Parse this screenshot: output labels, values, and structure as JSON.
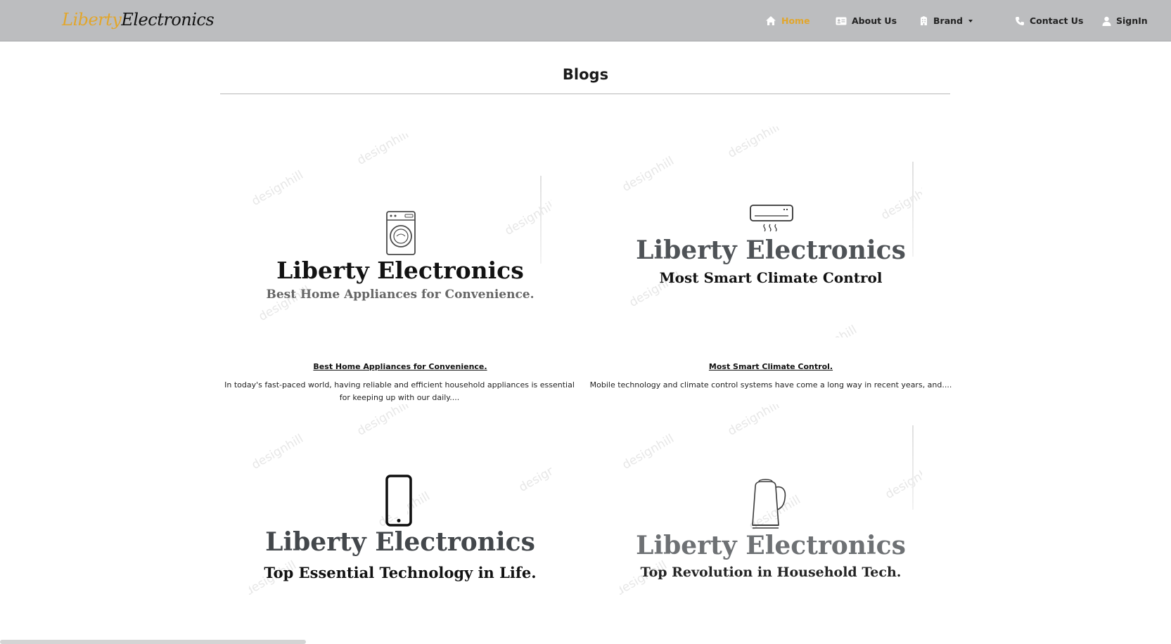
{
  "navbar": {
    "brand_part1": "Liberty",
    "brand_part2": "Electronics",
    "items": [
      {
        "label": "Home",
        "icon": "home-icon",
        "active": true
      },
      {
        "label": "About Us",
        "icon": "id-card-icon",
        "active": false
      },
      {
        "label": "Brand",
        "icon": "building-icon",
        "active": false,
        "dropdown": true
      },
      {
        "label": "Contact Us",
        "icon": "phone-icon",
        "active": false
      },
      {
        "label": "SignIn",
        "icon": "user-icon",
        "active": false
      }
    ]
  },
  "page": {
    "title": "Blogs"
  },
  "posts": [
    {
      "image_brand": "Liberty Electronics",
      "image_tagline": "Best Home Appliances for Convenience.",
      "image_icon": "washing-machine-icon",
      "title": "Best Home Appliances for Convenience.",
      "excerpt": "In today's fast-paced world, having reliable and efficient household appliances is essential for keeping up with our daily...."
    },
    {
      "image_brand": "Liberty Electronics",
      "image_tagline": "Most Smart Climate Control",
      "image_icon": "air-conditioner-icon",
      "title": "Most Smart Climate Control.",
      "excerpt": "Mobile technology and climate control systems have come a long way in recent years, and...."
    },
    {
      "image_brand": "Liberty Electronics",
      "image_tagline": "Top Essential Technology in Life.",
      "image_icon": "smartphone-icon"
    },
    {
      "image_brand": "Liberty Electronics",
      "image_tagline": "Top Revolution in Household Tech.",
      "image_icon": "kettle-icon"
    }
  ],
  "watermark": "designhill",
  "colors": {
    "navbar_bg": "#bcbdbf",
    "accent": "#e2a62b",
    "text": "#1a1a1a"
  }
}
